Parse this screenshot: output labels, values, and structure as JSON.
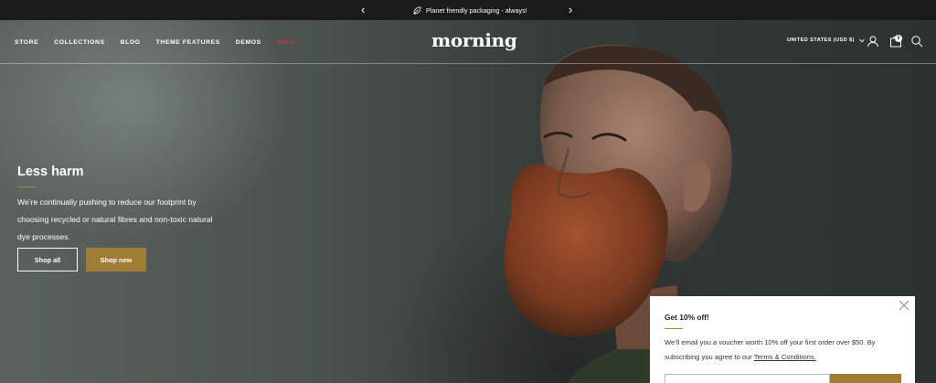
{
  "announcement": {
    "message": "Planet friendly packaging - always!",
    "prev_icon": "chevron-left-icon",
    "next_icon": "chevron-right-icon",
    "leaf_icon": "leaf-icon"
  },
  "header": {
    "logo": "morning",
    "nav": [
      {
        "label": "STORE"
      },
      {
        "label": "COLLECTIONS"
      },
      {
        "label": "BLOG"
      },
      {
        "label": "THEME FEATURES"
      },
      {
        "label": "DEMOS"
      },
      {
        "label": "SALE"
      }
    ],
    "region": "UNITED STATES (USD $)",
    "cart_count": "0",
    "icons": [
      "account-icon",
      "cart-icon",
      "search-icon"
    ]
  },
  "hero": {
    "title": "Less harm",
    "body": "We’re continually pushing to reduce our footprint by choosing recycled or natural fibres and non-toxic natural dye processes.",
    "primary_button": "Shop all",
    "secondary_button": "Shop new"
  },
  "popup": {
    "title": "Get 10% off!",
    "text_before_link": "We’ll email you a voucher worth 10% off your first order over $50. By subscribing you agree to our ",
    "link": "Terms & Conditions."
  },
  "colors": {
    "accent": "#9e7e35",
    "sale": "#c8402a",
    "announcement_bg": "#1b1b1b"
  }
}
